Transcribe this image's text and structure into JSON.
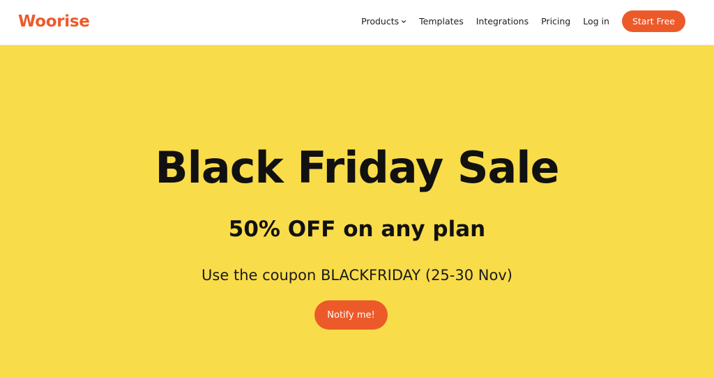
{
  "header": {
    "logo_text": "Woorise",
    "nav": {
      "products": "Products",
      "templates": "Templates",
      "integrations": "Integrations",
      "pricing": "Pricing",
      "login": "Log in"
    },
    "cta_label": "Start Free"
  },
  "hero": {
    "title": "Black Friday Sale",
    "subtitle": "50% OFF on any plan",
    "coupon_text": "Use the coupon BLACKFRIDAY (25-30 Nov)",
    "button_label": "Notify me!"
  },
  "colors": {
    "brand_orange": "#ec5a2a",
    "hero_yellow": "#f9dc4a",
    "text_dark": "#111111",
    "header_bg": "#ffffff"
  },
  "icons": {
    "products_dropdown": "chevron-down-icon"
  }
}
